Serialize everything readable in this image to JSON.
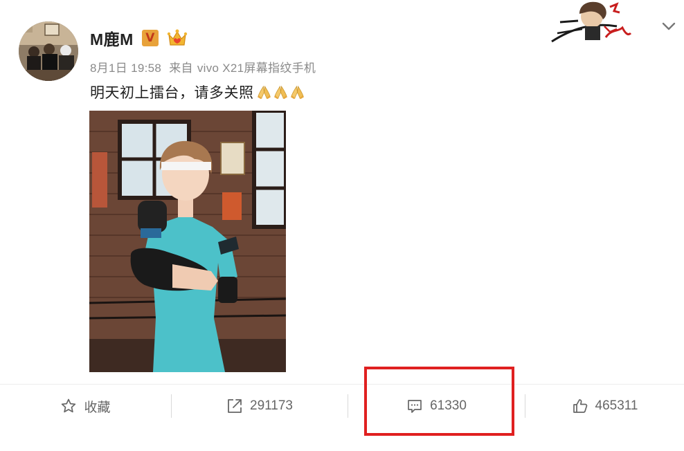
{
  "post": {
    "author": {
      "name": "M鹿M",
      "verified_badge": "V",
      "crown": "crown-icon"
    },
    "meta": {
      "date": "8月1日 19:58",
      "source_prefix": "来自",
      "device": "vivo X21屏幕指纹手机"
    },
    "text": "明天初上擂台，请多关照",
    "emojis": [
      "pray-icon",
      "pray-icon",
      "pray-icon"
    ],
    "image": {
      "alt_icon": "boxer-photo"
    }
  },
  "top_right": {
    "decoration": "signature-sticker",
    "menu": "chevron-down-icon"
  },
  "actions": {
    "favorite": {
      "label": "收藏",
      "icon": "star-icon"
    },
    "repost": {
      "count": "291173",
      "icon": "share-icon"
    },
    "comment": {
      "count": "61330",
      "icon": "comment-icon"
    },
    "like": {
      "count": "465311",
      "icon": "thumbs-up-icon"
    }
  },
  "colors": {
    "highlight": "#e02020",
    "text": "#222222",
    "meta": "#8a8a8a",
    "action_text": "#666666"
  }
}
